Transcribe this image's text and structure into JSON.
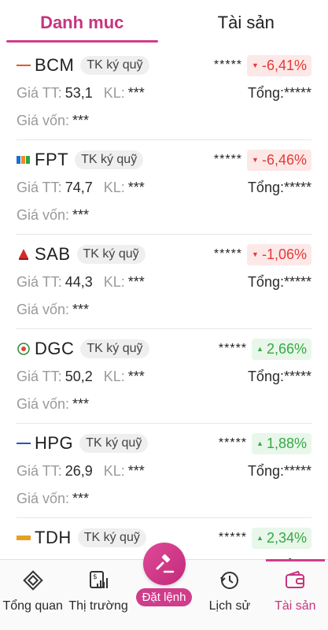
{
  "tabs": [
    {
      "label": "Danh muc",
      "active": true
    },
    {
      "label": "Tài sản",
      "active": false
    }
  ],
  "labels": {
    "price": "Giá TT:",
    "volume": "KL:",
    "total": "Tổng:",
    "cost": "Giá vốn:"
  },
  "holdings": [
    {
      "ticker": "BCM",
      "account": "TK ký quỹ",
      "amount_masked": "*****",
      "change": "-6,41%",
      "direction": "down",
      "price": "53,1",
      "volume": "***",
      "total": "*****",
      "cost": "***",
      "logo": "bcm-logo-icon"
    },
    {
      "ticker": "FPT",
      "account": "TK ký quỹ",
      "amount_masked": "*****",
      "change": "-6,46%",
      "direction": "down",
      "price": "74,7",
      "volume": "***",
      "total": "*****",
      "cost": "***",
      "logo": "fpt-logo-icon"
    },
    {
      "ticker": "SAB",
      "account": "TK ký quỹ",
      "amount_masked": "*****",
      "change": "-1,06%",
      "direction": "down",
      "price": "44,3",
      "volume": "***",
      "total": "*****",
      "cost": "***",
      "logo": "sab-logo-icon"
    },
    {
      "ticker": "DGC",
      "account": "TK ký quỹ",
      "amount_masked": "*****",
      "change": "2,66%",
      "direction": "up",
      "price": "50,2",
      "volume": "***",
      "total": "*****",
      "cost": "***",
      "logo": "dgc-logo-icon"
    },
    {
      "ticker": "HPG",
      "account": "TK ký quỹ",
      "amount_masked": "*****",
      "change": "1,88%",
      "direction": "up",
      "price": "26,9",
      "volume": "***",
      "total": "*****",
      "cost": "***",
      "logo": "hpg-logo-icon"
    },
    {
      "ticker": "TDH",
      "account": "TK ký quỹ",
      "amount_masked": "*****",
      "change": "2,34%",
      "direction": "up",
      "price": "",
      "volume": "",
      "total": "",
      "cost": "",
      "logo": "tdh-logo-icon"
    }
  ],
  "nav": {
    "items": [
      {
        "label": "Tổng quan",
        "icon": "overview-icon"
      },
      {
        "label": "Thị trường",
        "icon": "market-icon"
      },
      {
        "label": "Đặt lệnh",
        "icon": "gavel-icon"
      },
      {
        "label": "Lịch sử",
        "icon": "history-icon"
      },
      {
        "label": "Tài sản",
        "icon": "wallet-icon"
      }
    ],
    "active_index": 4
  },
  "colors": {
    "accent": "#cf3d8b",
    "down": "#e53935",
    "down_bg": "#fde8e8",
    "up": "#37a845",
    "up_bg": "#e8f7ea"
  }
}
